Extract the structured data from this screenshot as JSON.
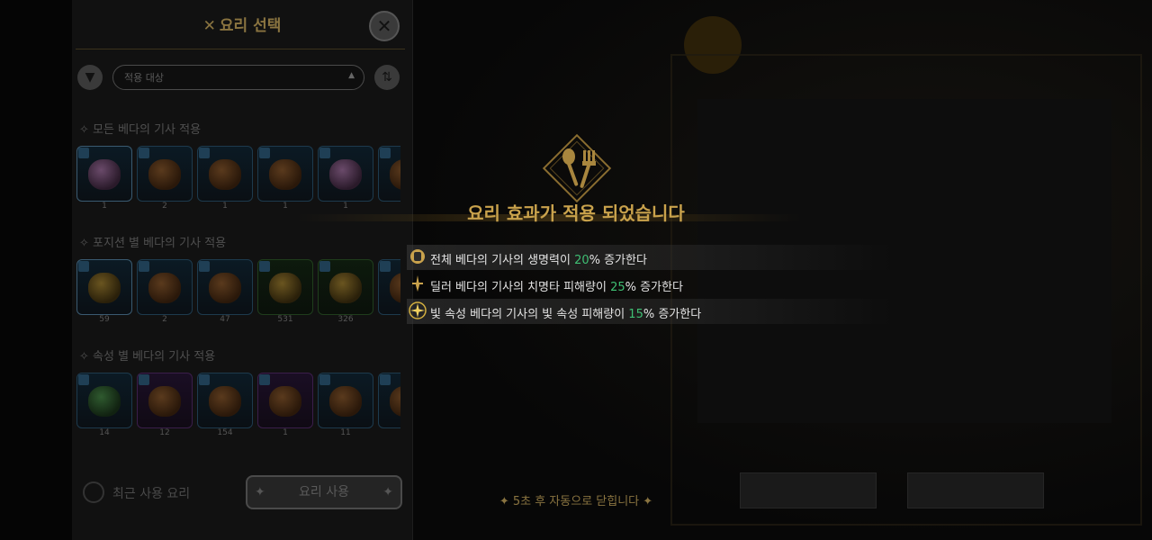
{
  "panel": {
    "title": "요리 선택",
    "filter_placeholder": "적용 대상",
    "sections": [
      {
        "title": "모든 베다의 기사 적용",
        "items": [
          {
            "qty": "1",
            "tone": "pink",
            "border": "sel"
          },
          {
            "qty": "2",
            "tone": "brown",
            "border": "blue"
          },
          {
            "qty": "1",
            "tone": "brown",
            "border": "blue"
          },
          {
            "qty": "1",
            "tone": "brown",
            "border": "blue"
          },
          {
            "qty": "1",
            "tone": "pink",
            "border": "blue"
          },
          {
            "qty": "",
            "tone": "brown",
            "border": "blue"
          }
        ]
      },
      {
        "title": "포지션 별 베다의 기사 적용",
        "items": [
          {
            "qty": "59",
            "tone": "yellow",
            "border": "sel"
          },
          {
            "qty": "2",
            "tone": "brown",
            "border": "blue"
          },
          {
            "qty": "47",
            "tone": "brown",
            "border": "blue"
          },
          {
            "qty": "531",
            "tone": "yellow",
            "border": "green"
          },
          {
            "qty": "326",
            "tone": "yellow",
            "border": "green"
          },
          {
            "qty": "",
            "tone": "brown",
            "border": "blue"
          }
        ]
      },
      {
        "title": "속성 별 베다의 기사 적용",
        "items": [
          {
            "qty": "14",
            "tone": "green",
            "border": "blue"
          },
          {
            "qty": "12",
            "tone": "brown",
            "border": "purple"
          },
          {
            "qty": "154",
            "tone": "brown",
            "border": "blue"
          },
          {
            "qty": "1",
            "tone": "brown",
            "border": "purple"
          },
          {
            "qty": "11",
            "tone": "brown",
            "border": "blue"
          },
          {
            "qty": "",
            "tone": "brown",
            "border": "blue"
          }
        ]
      }
    ],
    "recent_label": "최근 사용 요리",
    "use_button": "요리 사용"
  },
  "popup": {
    "headline": "요리 효과가 적용 되었습니다",
    "effects": [
      {
        "pre": "전체 베다의 기사의 생명력이 ",
        "num": "20",
        "post": "% 증가한다",
        "icon": "tank-class-icon"
      },
      {
        "pre": "딜러 베다의 기사의 치명타 피해량이 ",
        "num": "25",
        "post": "% 증가한다",
        "icon": "dealer-class-icon"
      },
      {
        "pre": "빛 속성 베다의 기사의 빛 속성 피해량이 ",
        "num": "15",
        "post": "% 증가한다",
        "icon": "light-element-icon"
      }
    ],
    "autoclose": "✦ 5초 후 자동으로 닫힙니다 ✦"
  },
  "colors": {
    "accent_gold": "#c9a24c",
    "value_green": "#3fbf73"
  }
}
